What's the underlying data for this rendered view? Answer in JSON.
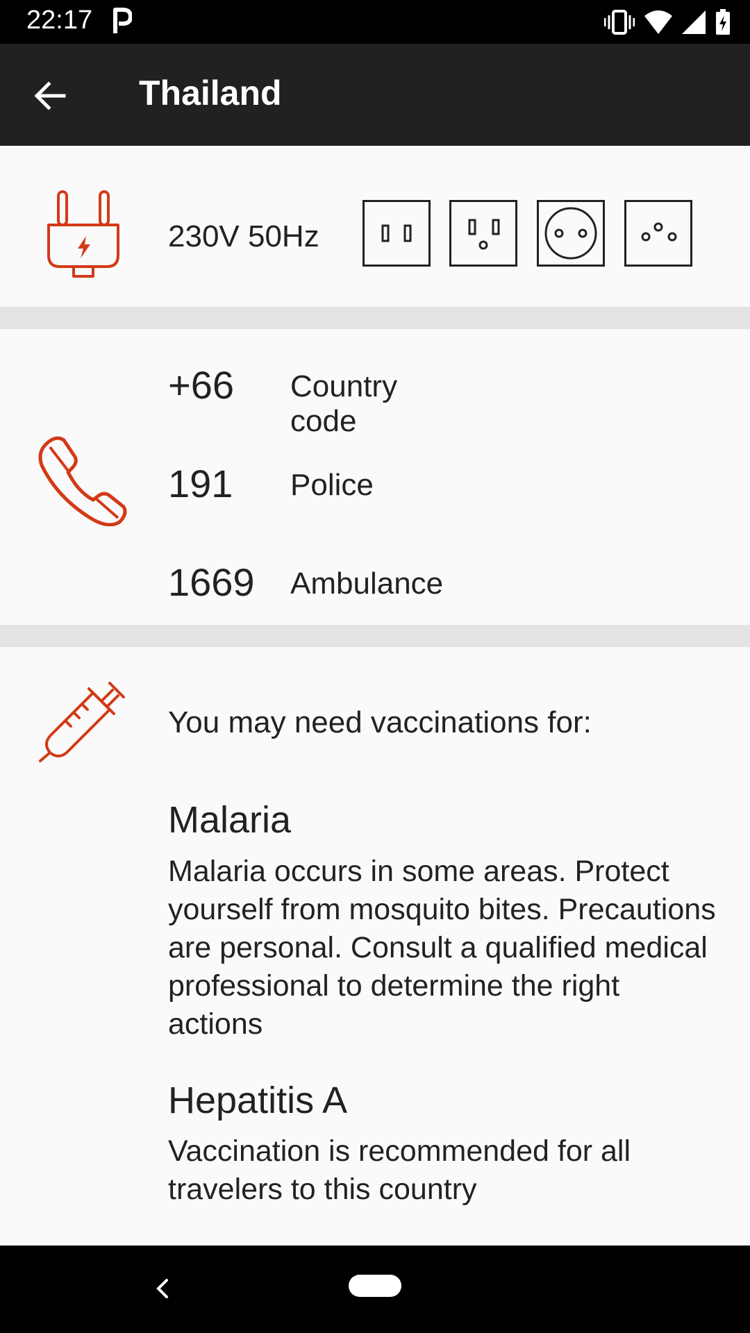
{
  "status_bar": {
    "time": "22:17"
  },
  "app_bar": {
    "title": "Thailand"
  },
  "power": {
    "voltage": "230V 50Hz"
  },
  "phone": {
    "rows": [
      {
        "number": "+66",
        "label": "Country code"
      },
      {
        "number": "191",
        "label": "Police"
      },
      {
        "number": "1669",
        "label": "Ambulance"
      }
    ]
  },
  "vaccinations": {
    "intro": "You may need vaccinations for:",
    "items": [
      {
        "name": "Malaria",
        "description": "Malaria occurs in some areas. Protect yourself from mosquito bites. Precautions are personal. Consult a qualified medical professional to determine the right actions"
      },
      {
        "name": "Hepatitis A",
        "description": "Vaccination is recommended for all travelers to this country"
      }
    ]
  },
  "colors": {
    "accent": "#d33a17",
    "app_bar": "#212121",
    "divider": "#e3e3e3",
    "background": "#fafafa"
  }
}
